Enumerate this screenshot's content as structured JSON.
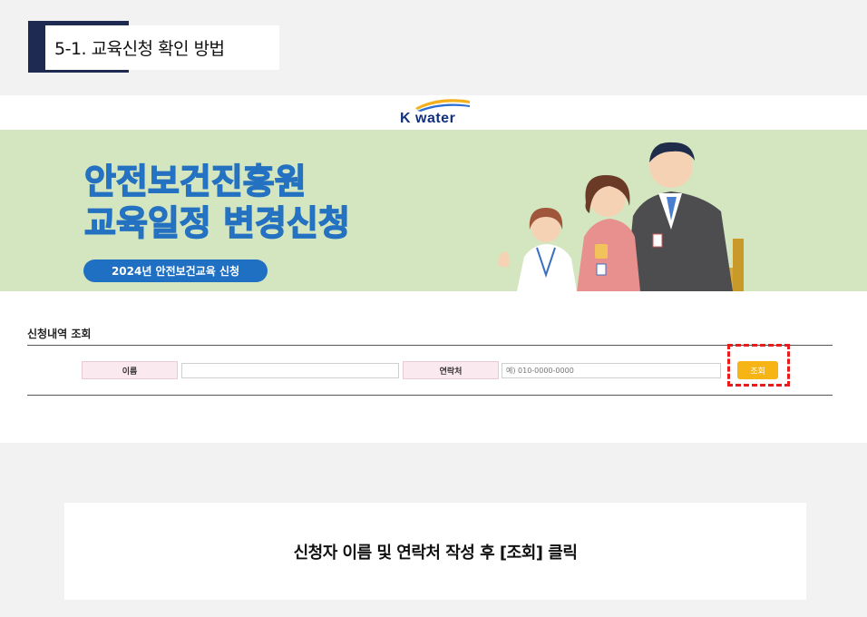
{
  "section": {
    "title": "5-1. 교육신청 확인 방법"
  },
  "site": {
    "logo_text": "K water"
  },
  "banner": {
    "title_line1": "안전보건진흥원",
    "title_line2": "교육일정 변경신청",
    "pill": "2024년 안전보건교육 신청"
  },
  "form": {
    "title": "신청내역 조회",
    "name_label": "이름",
    "name_value": "",
    "phone_label": "연락처",
    "phone_placeholder": "예) 010-0000-0000",
    "search_button": "조회"
  },
  "caption": {
    "text": "신청자 이름 및 연락처 작성 후 [조회] 클릭"
  },
  "colors": {
    "header_bar": "#1f2a52",
    "banner_bg": "#d3e6c0",
    "banner_title": "#2a7fcf",
    "pill_bg": "#1f6fc2",
    "button": "#f7b515",
    "highlight": "#e81c1c"
  }
}
